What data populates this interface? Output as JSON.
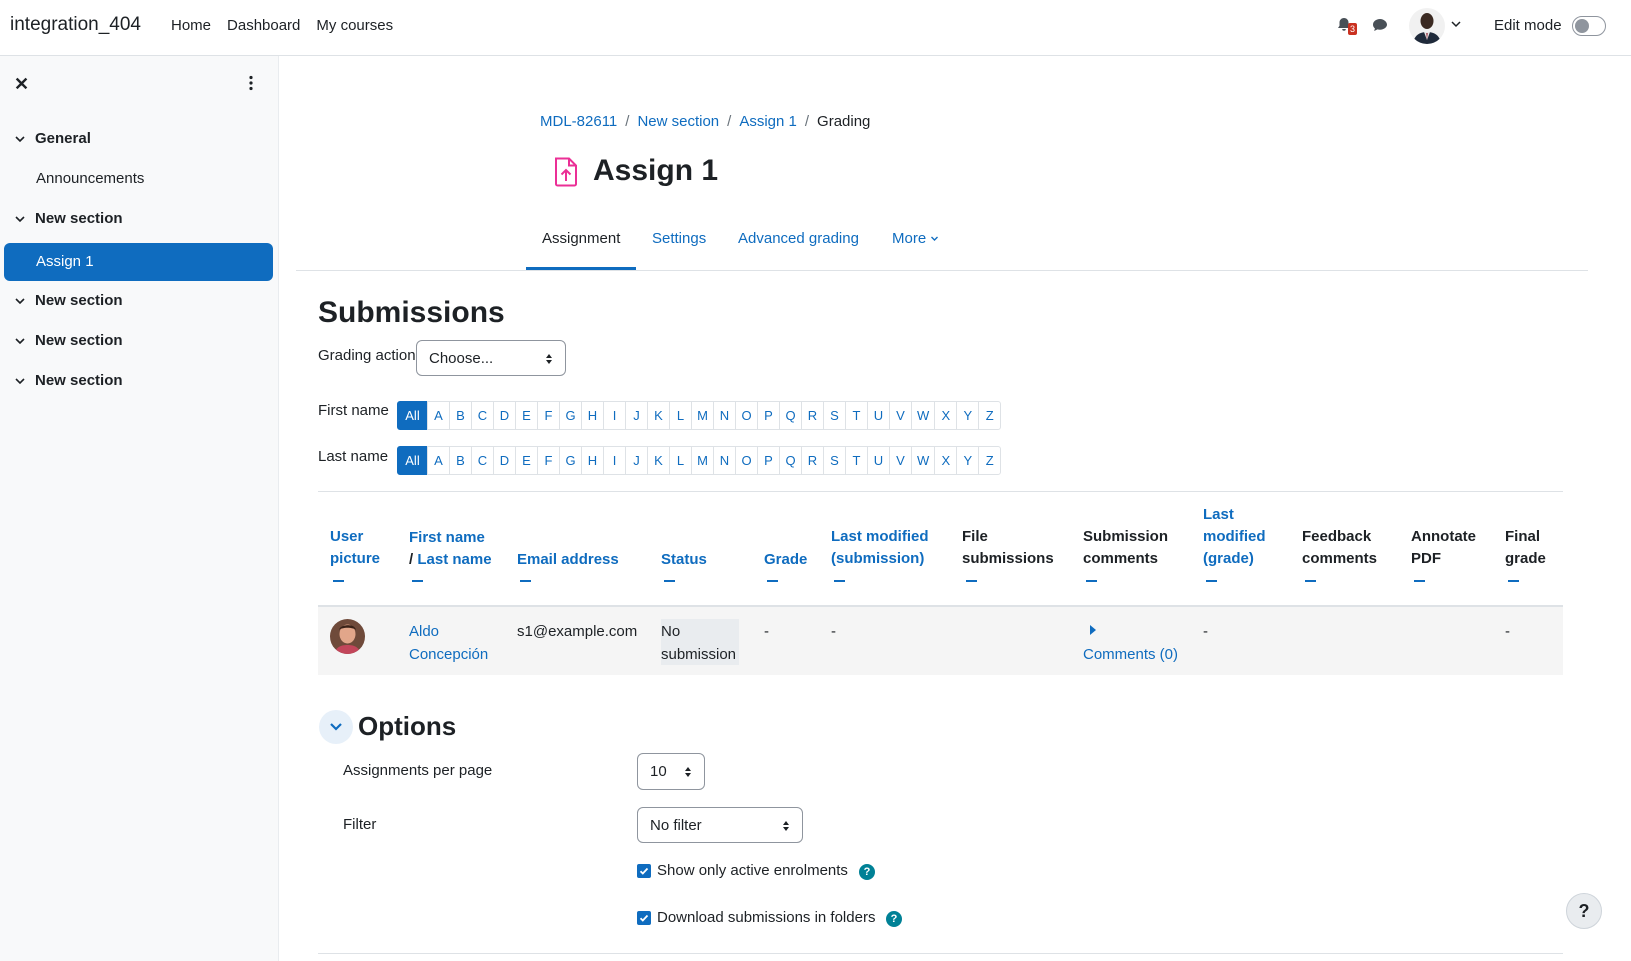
{
  "navbar": {
    "brand": "integration_404",
    "links": [
      "Home",
      "Dashboard",
      "My courses"
    ],
    "notification_count": "3",
    "edit_mode_label": "Edit mode"
  },
  "drawer": {
    "items": [
      {
        "label": "General",
        "type": "section"
      },
      {
        "label": "Announcements",
        "type": "activity"
      },
      {
        "label": "New section",
        "type": "section"
      },
      {
        "label": "Assign 1",
        "type": "activity",
        "active": true
      },
      {
        "label": "New section",
        "type": "section"
      },
      {
        "label": "New section",
        "type": "section"
      },
      {
        "label": "New section",
        "type": "section"
      }
    ]
  },
  "breadcrumb": {
    "items": [
      "MDL-82611",
      "New section",
      "Assign 1"
    ],
    "current": "Grading"
  },
  "page": {
    "title": "Assign 1",
    "icon": "assign-upload-icon"
  },
  "tabs": [
    "Assignment",
    "Settings",
    "Advanced grading",
    "More"
  ],
  "submissions": {
    "heading": "Submissions",
    "grading_action_label": "Grading action",
    "grading_action_value": "Choose...",
    "first_name_label": "First name",
    "last_name_label": "Last name",
    "initials": [
      "All",
      "A",
      "B",
      "C",
      "D",
      "E",
      "F",
      "G",
      "H",
      "I",
      "J",
      "K",
      "L",
      "M",
      "N",
      "O",
      "P",
      "Q",
      "R",
      "S",
      "T",
      "U",
      "V",
      "W",
      "X",
      "Y",
      "Z"
    ]
  },
  "table": {
    "headers": {
      "user_picture": [
        "User",
        "picture"
      ],
      "first_name": "First name",
      "slash": "/ ",
      "last_name": "Last name",
      "email": "Email address",
      "status": "Status",
      "grade": "Grade",
      "last_modified_submission": [
        "Last modified",
        "(submission)"
      ],
      "file_submissions": [
        "File",
        "submissions"
      ],
      "submission_comments": [
        "Submission",
        "comments"
      ],
      "last_modified_grade": [
        "Last",
        "modified",
        "(grade)"
      ],
      "feedback_comments": [
        "Feedback",
        "comments"
      ],
      "annotate_pdf": [
        "Annotate",
        "PDF"
      ],
      "final_grade": [
        "Final",
        "grade"
      ]
    },
    "rows": [
      {
        "first_name": "Aldo",
        "last_name": "Concepción",
        "email": "s1@example.com",
        "status": [
          "No",
          "submission"
        ],
        "grade": "-",
        "last_modified_submission": "-",
        "comments": "Comments (0)",
        "last_modified_grade": "-",
        "final_grade": "-"
      }
    ]
  },
  "options": {
    "heading": "Options",
    "per_page_label": "Assignments per page",
    "per_page_value": "10",
    "filter_label": "Filter",
    "filter_value": "No filter",
    "active_enrolments_label": "Show only active enrolments",
    "download_folders_label": "Download submissions in folders"
  },
  "help_button": "?",
  "colors": {
    "primary": "#0f6cbf",
    "badge": "#ca3120",
    "help_icon": "#008196",
    "assign_icon": "#eb2f96"
  }
}
